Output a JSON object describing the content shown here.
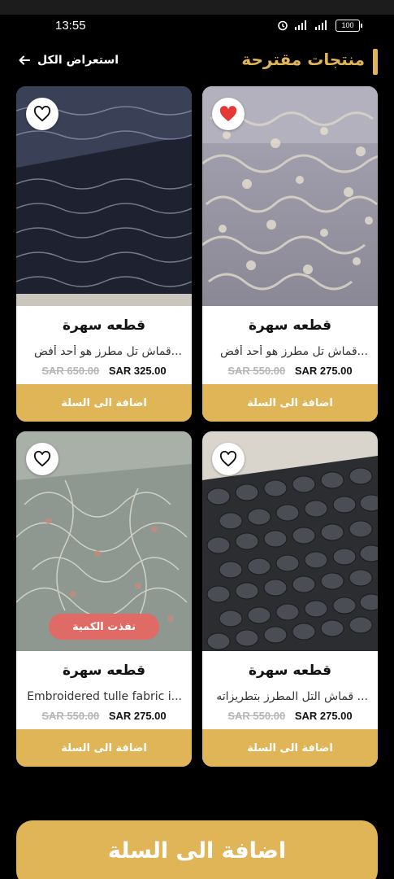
{
  "status": {
    "time": "13:55",
    "battery": "100"
  },
  "header": {
    "title": "منتجات مقترحة",
    "view_all": "استعراض الكل"
  },
  "products": [
    {
      "name": "قطعه سهرة",
      "desc": "قماش تل مطرز هو أحد أفض...",
      "old_price": "SAR 550.00",
      "new_price": "SAR 275.00",
      "add_label": "اضافة الى السلة",
      "favorited": true
    },
    {
      "name": "قطعه سهرة",
      "desc": "قماش تل مطرز هو أحد أفض...",
      "old_price": "SAR 650.00",
      "new_price": "SAR 325.00",
      "add_label": "اضافة الى السلة",
      "favorited": false
    },
    {
      "name": "قطعه سهرة",
      "desc": "قماش التل المطرز بتطريزاته ...",
      "old_price": "SAR 550.00",
      "new_price": "SAR 275.00",
      "add_label": "اضافة الى السلة",
      "favorited": false
    },
    {
      "name": "قطعه سهرة",
      "desc": "Embroidered tulle fabric i...",
      "old_price": "SAR 550.00",
      "new_price": "SAR 275.00",
      "add_label": "اضافة الى السلة",
      "favorited": false,
      "badge": "نفذت الكمية"
    }
  ],
  "bottom_button": "اضافة الى السلة",
  "colors": {
    "accent": "#e0b558",
    "heart": "#e53935",
    "soldout": "#e06a66"
  }
}
